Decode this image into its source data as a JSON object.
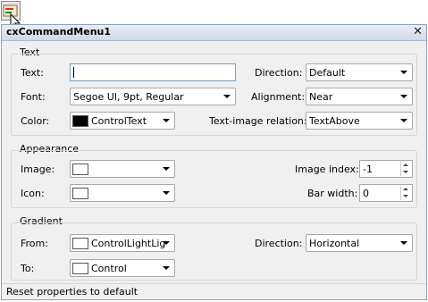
{
  "window": {
    "title": "cxCommandMenu1",
    "close_glyph": "✕"
  },
  "groups": {
    "text": "Text",
    "appearance": "Appearance",
    "gradient": "Gradient"
  },
  "text_group": {
    "text_label": "Text:",
    "text_value": "",
    "font_label": "Font:",
    "font_value": "Segoe UI, 9pt, Regular",
    "color_label": "Color:",
    "color_value": "ControlText",
    "color_swatch": "#000000",
    "direction_label": "Direction:",
    "direction_value": "Default",
    "alignment_label": "Alignment:",
    "alignment_value": "Near",
    "relation_label": "Text-image relation:",
    "relation_value": "TextAbove"
  },
  "appearance_group": {
    "image_label": "Image:",
    "icon_label": "Icon:",
    "image_index_label": "Image index:",
    "image_index_value": "-1",
    "bar_width_label": "Bar width:",
    "bar_width_value": "0"
  },
  "gradient_group": {
    "from_label": "From:",
    "from_value": "ControlLightLig",
    "from_swatch": "#ffffff",
    "to_label": "To:",
    "to_value": "Control",
    "to_swatch": "#ffffff",
    "direction_label": "Direction:",
    "direction_value": "Horizontal"
  },
  "status": "Reset properties to default"
}
